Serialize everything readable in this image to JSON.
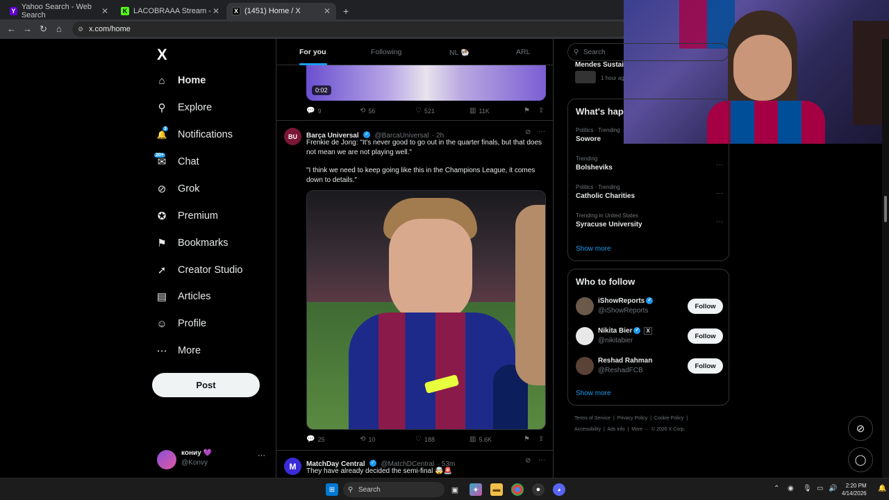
{
  "browser": {
    "tabs": [
      {
        "title": "Yahoo Search - Web Search",
        "favicon": "Y",
        "color": "#6001d2"
      },
      {
        "title": "LACOBRAAA Stream - Watch L",
        "favicon": "K",
        "color": "#53fc18"
      },
      {
        "title": "(1451) Home / X",
        "favicon": "X",
        "color": "#000000"
      }
    ],
    "new_tab": "+",
    "url": "x.com/home"
  },
  "sidebar": {
    "logo": "X",
    "items": [
      {
        "label": "Home",
        "icon": "home-icon",
        "glyph": "⌂"
      },
      {
        "label": "Explore",
        "icon": "search-icon",
        "glyph": "⚲"
      },
      {
        "label": "Notifications",
        "icon": "bell-icon",
        "glyph": "🔔",
        "badge": "3"
      },
      {
        "label": "Chat",
        "icon": "mail-icon",
        "glyph": "✉",
        "badge": "20+"
      },
      {
        "label": "Grok",
        "icon": "grok-icon",
        "glyph": "⊘"
      },
      {
        "label": "Premium",
        "icon": "verified-icon",
        "glyph": "✪"
      },
      {
        "label": "Bookmarks",
        "icon": "bookmark-icon",
        "glyph": "⚑"
      },
      {
        "label": "Creator Studio",
        "icon": "rocket-icon",
        "glyph": "➚"
      },
      {
        "label": "Articles",
        "icon": "article-icon",
        "glyph": "▤"
      },
      {
        "label": "Profile",
        "icon": "person-icon",
        "glyph": "☺"
      },
      {
        "label": "More",
        "icon": "more-circle-icon",
        "glyph": "⋯"
      }
    ],
    "post_label": "Post",
    "account": {
      "name": "кониу 💜",
      "handle": "@Konvy",
      "more": "···"
    }
  },
  "feed": {
    "tabs": [
      {
        "label": "For you"
      },
      {
        "label": "Following"
      },
      {
        "label": "NL 🐏"
      },
      {
        "label": "ARL"
      }
    ],
    "prev_tweet": {
      "video_time": "0:02",
      "replies": "9",
      "reposts": "56",
      "likes": "521",
      "views": "11K"
    },
    "tweet1": {
      "name": "Barça Universal",
      "handle": "@BarcaUniversal",
      "time": "· 2h",
      "text1": "Frenkie de Jong: \"It's never good to go out in the quarter finals, but that does not mean we are not playing well.\"",
      "text2": "\"I think we need to keep going like this in the Champions League, it comes down to details.\"",
      "avatar_text": "BU",
      "replies": "25",
      "reposts": "10",
      "likes": "188",
      "views": "5.6K"
    },
    "tweet2": {
      "name": "MatchDay Central",
      "handle": "@MatchDCentral",
      "time": "· 53m",
      "text": "They have already decided the semi-final 🤯🚨",
      "avatar_text": "M"
    }
  },
  "right": {
    "search_placeholder": "Search",
    "partial_item": {
      "name": "Mendes Sustai",
      "meta": "1 hour ag"
    },
    "trends_title": "What's hap",
    "trends": [
      {
        "meta": "Politics · Trending",
        "name": "Sowore"
      },
      {
        "meta": "Trending",
        "name": "Bolsheviks"
      },
      {
        "meta": "Politics · Trending",
        "name": "Catholic Charities"
      },
      {
        "meta": "Trending in United States",
        "name": "Syracuse University"
      }
    ],
    "trends_more": "Show more",
    "follow_title": "Who to follow",
    "follow": [
      {
        "name": "iShowReports",
        "handle": "@iShowReports",
        "button": "Follow"
      },
      {
        "name": "Nikita Bier",
        "handle": "@nikitabier",
        "button": "Follow"
      },
      {
        "name": "Reshad Rahman",
        "handle": "@ReshadFCB",
        "button": "Follow"
      }
    ],
    "follow_more": "Show more",
    "footer1": [
      "Terms of Service",
      "Privacy Policy",
      "Cookie Policy"
    ],
    "footer2": [
      "Accessibility",
      "Ads info",
      "More ···",
      "© 2026 X Corp."
    ]
  },
  "taskbar": {
    "search": "Search",
    "time": "2:20 PM",
    "date": "4/14/2026"
  }
}
